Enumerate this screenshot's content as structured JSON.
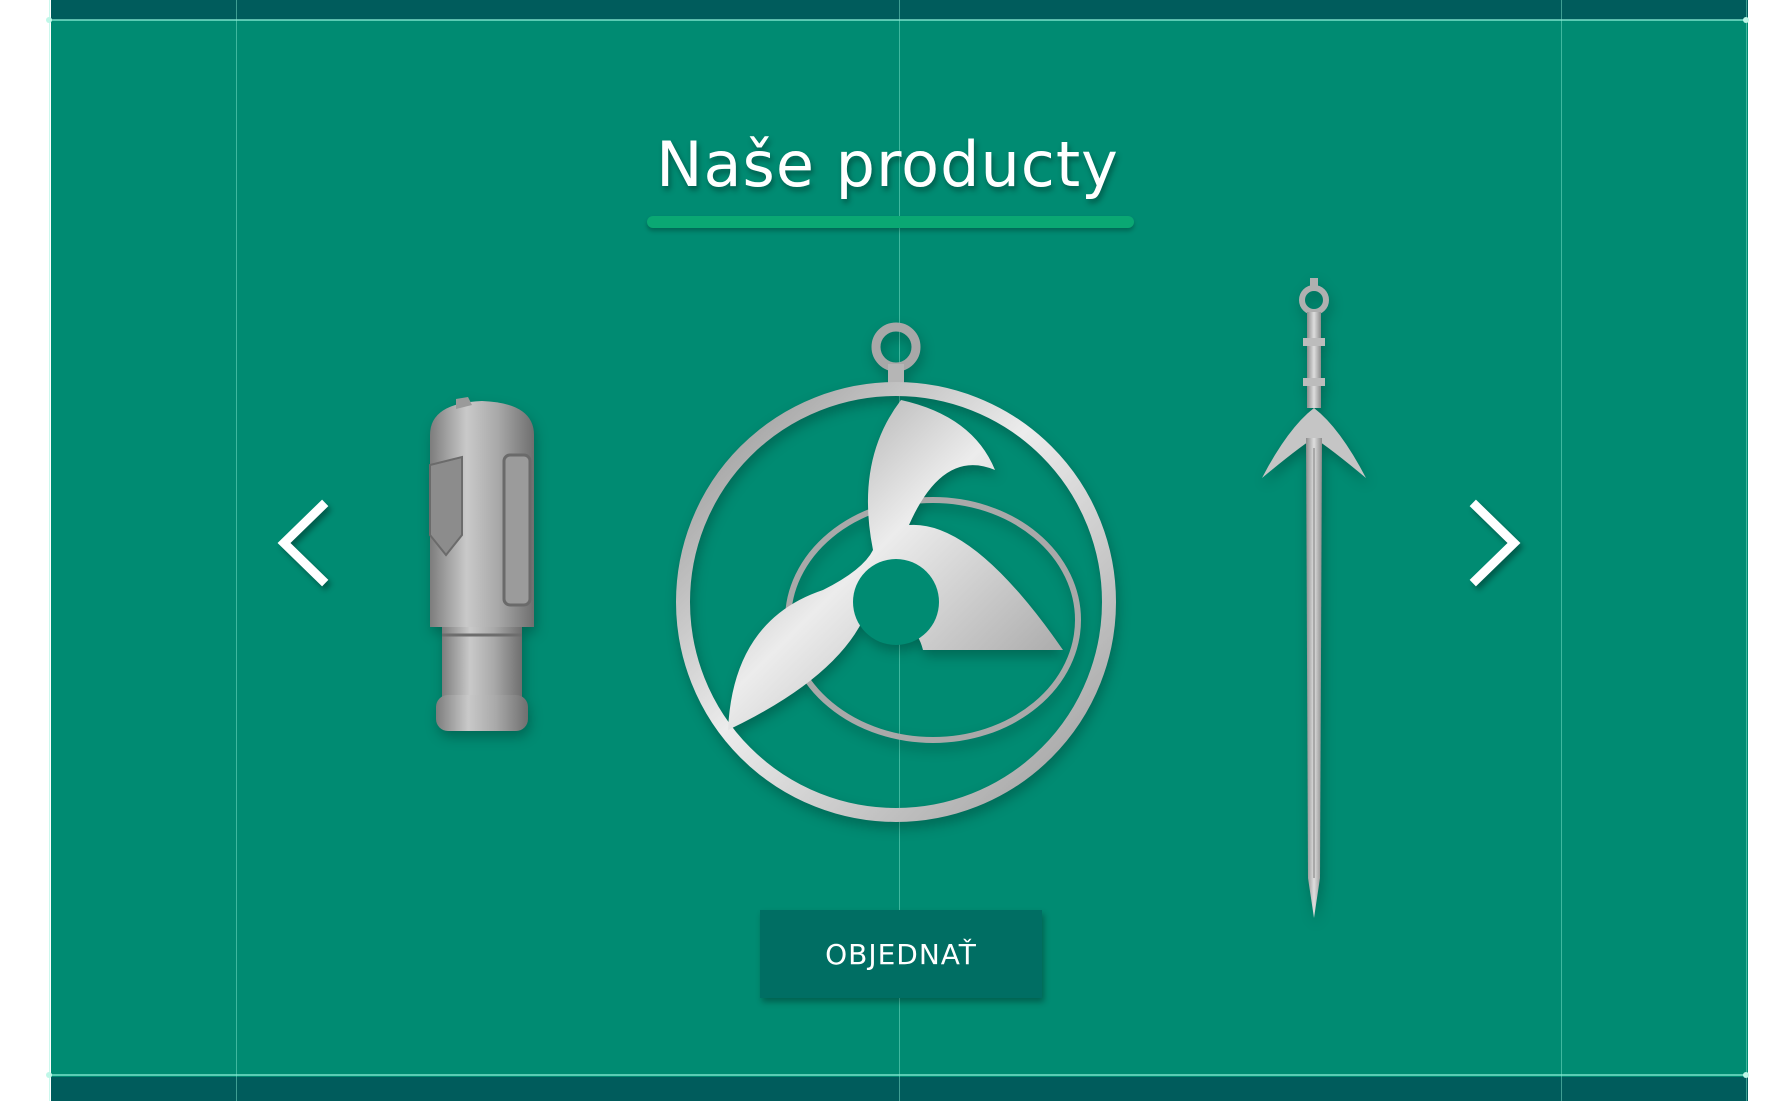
{
  "section": {
    "title": "Naše producty",
    "order_button_label": "OBJEDNAŤ"
  },
  "carousel": {
    "prev_icon": "chevron-left-icon",
    "next_icon": "chevron-right-icon",
    "items": [
      {
        "name": "cylinder-product"
      },
      {
        "name": "pendant-product"
      },
      {
        "name": "sword-product"
      }
    ]
  },
  "colors": {
    "section_background": "#008b72",
    "strip": "#005c5c",
    "underline": "#0aa873",
    "button": "#006e63",
    "text": "#ffffff"
  }
}
